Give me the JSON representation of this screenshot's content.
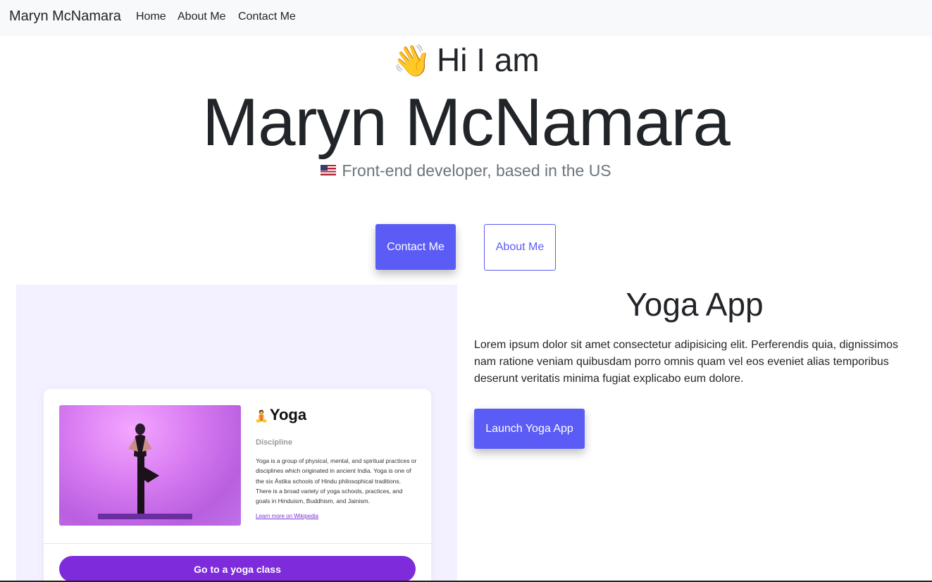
{
  "nav": {
    "brand": "Maryn McNamara",
    "links": [
      "Home",
      "About Me",
      "Contact Me"
    ]
  },
  "hero": {
    "wave_icon": "👋",
    "greeting": "Hi I am",
    "name": "Maryn McNamara",
    "flag_icon": "us-flag-icon",
    "subtitle": "Front-end developer, based in the US",
    "contact_button": "Contact Me",
    "about_button": "About Me"
  },
  "project": {
    "title": "Yoga App",
    "description": "Lorem ipsum dolor sit amet consectetur adipisicing elit. Perferendis quia, dignissimos nam ratione veniam quibusdam porro omnis quam vel eos eveniet alias temporibus deserunt veritatis minima fugiat explicabo eum dolore.",
    "launch_button": "Launch Yoga App",
    "preview": {
      "lotus_icon": "🧘",
      "title": "Yoga",
      "label": "Discipline",
      "description": "Yoga is a group of physical, mental, and spiritual practices or disciplines which originated in ancient India. Yoga is one of the six Āstika schools of Hindu philosophical traditions. There is a broad variety of yoga schools, practices, and goals in Hinduism, Buddhism, and Jainism.",
      "link": "Learn more on Wikipedia",
      "button": "Go to a yoga class"
    }
  },
  "colors": {
    "accent": "#5b5cf6",
    "preview_button": "#7e2bdc",
    "preview_bg": "#f3f0ff",
    "nav_bg": "#f8f9fa"
  }
}
